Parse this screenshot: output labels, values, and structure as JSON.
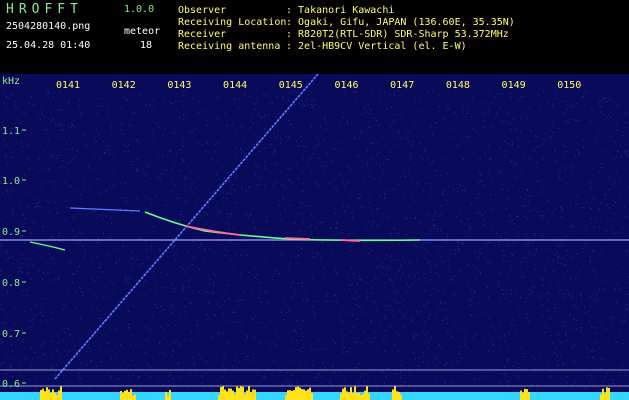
{
  "header": {
    "title": "HROFFT",
    "version": "1.0.0",
    "filename": "2504280140.png",
    "datetime": "25.04.28 01:40",
    "meteor_label": "meteor",
    "meteor_count": "18"
  },
  "meta": [
    {
      "key": "Observer",
      "value": ": Takanori Kawachi"
    },
    {
      "key": "Receiving Location",
      "value": ": Ogaki, Gifu, JAPAN (136.60E, 35.35N)"
    },
    {
      "key": "Receiver",
      "value": ": R820T2(RTL-SDR) SDR-Sharp 53.372MHz"
    },
    {
      "key": "Receiving antenna",
      "value": ": 2el-HB9CV Vertical (el. E-W)"
    }
  ],
  "spectrogram": {
    "y_unit": "kHz",
    "y_ticks": [
      "1.1",
      "1.0",
      "0.9",
      "0.8",
      "0.7",
      "0.6"
    ],
    "time_ticks": [
      "0141",
      "0142",
      "0143",
      "0144",
      "0145",
      "0146",
      "0147",
      "0148",
      "0149",
      "0150"
    ],
    "colors": {
      "background": "#0a0a5a",
      "noise": "#2a2aa0",
      "tick_text": "#ffff66",
      "axis_text": "#8fe88f",
      "carrier": "#9aa6ff",
      "trail": "#5f7dff",
      "echo_hot": "#ff6aa0",
      "echo_warm": "#6aff8a",
      "bottom_cyan": "#35d6ff",
      "bottom_yellow": "#ffe21a"
    }
  }
}
